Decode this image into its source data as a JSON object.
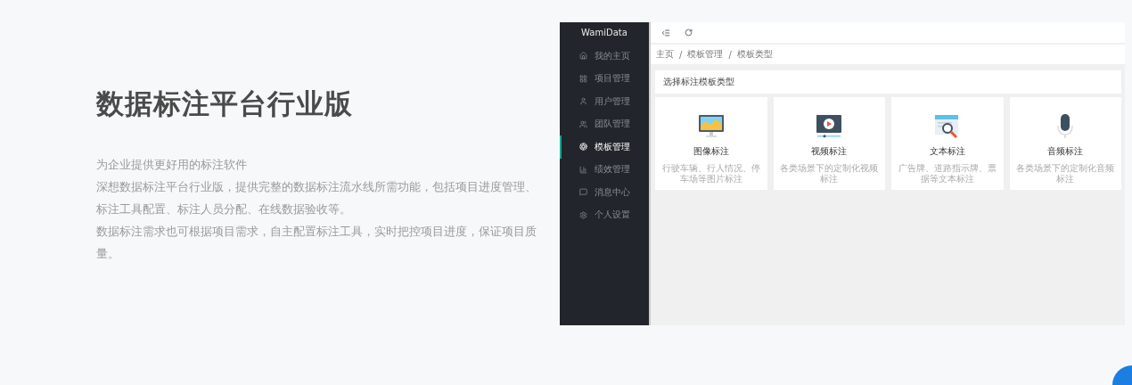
{
  "hero": {
    "title": "数据标注平台行业版",
    "paragraphs": [
      "为企业提供更好用的标注软件",
      "深想数据标注平台行业版，提供完整的数据标注流水线所需功能，包括项目进度管理、标注工具配置、标注人员分配、在线数据验收等。",
      "数据标注需求也可根据项目需求，自主配置标注工具，实时把控项目进度，保证项目质量。"
    ]
  },
  "app": {
    "brand": "WamiData",
    "sidebar": {
      "items": [
        {
          "label": "我的主页",
          "selected": false
        },
        {
          "label": "项目管理",
          "selected": false
        },
        {
          "label": "用户管理",
          "selected": false
        },
        {
          "label": "团队管理",
          "selected": false
        },
        {
          "label": "模板管理",
          "selected": true
        },
        {
          "label": "绩效管理",
          "selected": false
        },
        {
          "label": "消息中心",
          "selected": false
        },
        {
          "label": "个人设置",
          "selected": false
        }
      ]
    },
    "breadcrumb": [
      "主页",
      "模板管理",
      "模板类型"
    ],
    "breadcrumb_separator": "/",
    "panel_title": "选择标注模板类型",
    "cards": [
      {
        "kind": "image",
        "title": "图像标注",
        "description": "行驶车辆、行人情况、停车场等图片标注"
      },
      {
        "kind": "video",
        "title": "视频标注",
        "description": "各类场景下的定制化视频标注"
      },
      {
        "kind": "text",
        "title": "文本标注",
        "description": "广告牌、道路指示牌、票据等文本标注"
      },
      {
        "kind": "audio",
        "title": "音频标注",
        "description": "各类场景下的定制化音频标注"
      }
    ]
  }
}
